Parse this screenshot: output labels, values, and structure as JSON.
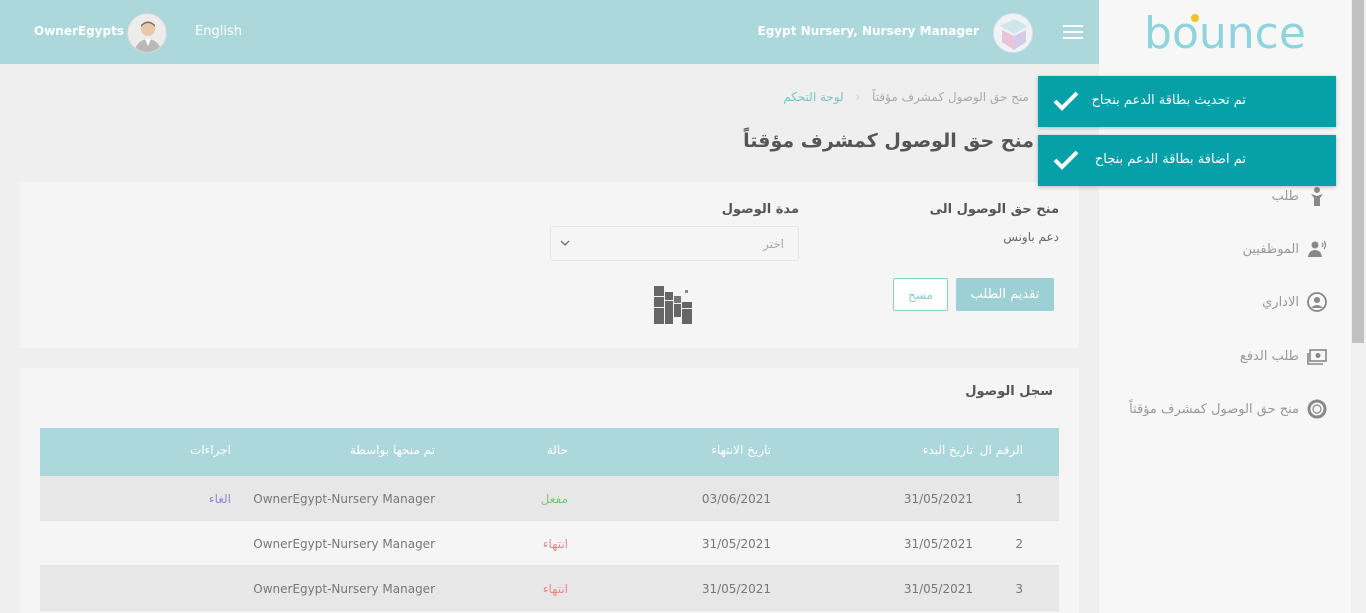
{
  "header": {
    "user_name": "OwnerEgypts",
    "language": "English",
    "org_label": "Egypt Nursery, Nursery Manager"
  },
  "sidebar": {
    "logo_text": "bounce",
    "items": [
      {
        "label": "طلب",
        "icon": "request-icon"
      },
      {
        "label": "الموظفيين",
        "icon": "employees-icon"
      },
      {
        "label": "الاداري",
        "icon": "admin-icon"
      },
      {
        "label": "طلب الدفع",
        "icon": "payment-icon"
      },
      {
        "label": "منح حق الوصول كمشرف مؤقتاً",
        "icon": "lifebuoy-icon"
      }
    ]
  },
  "breadcrumb": {
    "home": "لوحة التحكم",
    "current": "منح حق الوصول كمشرف مؤقتاً"
  },
  "page_title": "منح حق الوصول كمشرف مؤقتاً",
  "form": {
    "grant_label": "منح حق الوصول الى",
    "grant_value": "دعم باونس",
    "duration_label": "مدة الوصول",
    "duration_placeholder": "اختر",
    "submit_label": "تقديم الطلب",
    "clear_label": "مسح"
  },
  "log": {
    "title": "سجل الوصول",
    "columns": {
      "id": "الرقم ال",
      "start": "تاريخ البدء",
      "end": "تاريخ الانتهاء",
      "status": "حالة",
      "granted_by": "تم منحها بواسطة",
      "actions": "اجراءات"
    },
    "rows": [
      {
        "id": "1",
        "start": "31/05/2021",
        "end": "03/06/2021",
        "status": "مفعل",
        "granted_by": "OwnerEgypt-Nursery Manager",
        "action": "الغاء"
      },
      {
        "id": "2",
        "start": "31/05/2021",
        "end": "31/05/2021",
        "status": "انتهاء",
        "granted_by": "OwnerEgypt-Nursery Manager",
        "action": ""
      },
      {
        "id": "3",
        "start": "31/05/2021",
        "end": "31/05/2021",
        "status": "انتهاء",
        "granted_by": "OwnerEgypt-Nursery Manager",
        "action": ""
      }
    ]
  },
  "toasts": [
    {
      "message": "تم تحديث بطاقة الدعم بنجاح"
    },
    {
      "message": "تم اضافة بطاقة الدعم بنجاح"
    }
  ],
  "colors": {
    "header_bg": "#acd8db",
    "toast_bg": "#06a0a8",
    "active_status": "#7bc67b",
    "expired_status": "#ee8888"
  }
}
